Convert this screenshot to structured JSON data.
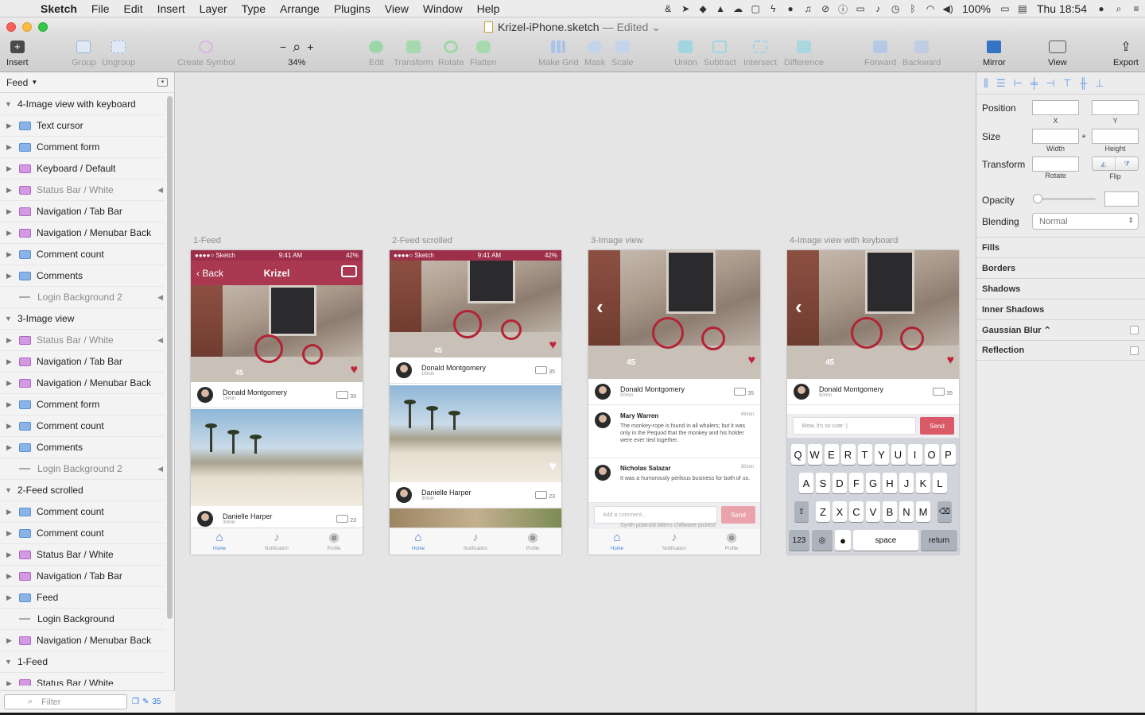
{
  "menubar": {
    "app_name": "Sketch",
    "items": [
      "File",
      "Edit",
      "Insert",
      "Layer",
      "Type",
      "Arrange",
      "Plugins",
      "View",
      "Window",
      "Help"
    ],
    "battery": "100%",
    "clock": "Thu 18:54"
  },
  "window": {
    "doc_title": "Krizel-iPhone.sketch",
    "dash": "—",
    "edited": "Edited"
  },
  "toolbar": {
    "insert": "Insert",
    "group": "Group",
    "ungroup": "Ungroup",
    "create_symbol": "Create Symbol",
    "zoom_minus": "−",
    "zoom_plus": "+",
    "zoom_level": "34%",
    "edit": "Edit",
    "transform": "Transform",
    "rotate": "Rotate",
    "flatten": "Flatten",
    "make_grid": "Make Grid",
    "mask": "Mask",
    "scale": "Scale",
    "union": "Union",
    "subtract": "Subtract",
    "intersect": "Intersect",
    "difference": "Difference",
    "forward": "Forward",
    "backward": "Backward",
    "mirror": "Mirror",
    "view": "View",
    "export": "Export"
  },
  "sidebar": {
    "page": "Feed",
    "filter_placeholder": "Filter",
    "count": "35",
    "layers": [
      {
        "label": "4-Image view with keyboard",
        "kind": "artboard"
      },
      {
        "label": "Text cursor",
        "kind": "folder",
        "color": "blue"
      },
      {
        "label": "Comment form",
        "kind": "folder",
        "color": "blue"
      },
      {
        "label": "Keyboard / Default",
        "kind": "folder",
        "color": "purple"
      },
      {
        "label": "Status Bar / White",
        "kind": "folder",
        "color": "purple",
        "hidden": true
      },
      {
        "label": "Navigation / Tab Bar",
        "kind": "folder",
        "color": "purple"
      },
      {
        "label": "Navigation / Menubar Back",
        "kind": "folder",
        "color": "purple"
      },
      {
        "label": "Comment count",
        "kind": "folder",
        "color": "blue"
      },
      {
        "label": "Comments",
        "kind": "folder",
        "color": "blue"
      },
      {
        "label": "Login Background 2",
        "kind": "rect",
        "hidden": true
      },
      {
        "label": "3-Image view",
        "kind": "artboard"
      },
      {
        "label": "Status Bar / White",
        "kind": "folder",
        "color": "purple",
        "hidden": true
      },
      {
        "label": "Navigation / Tab Bar",
        "kind": "folder",
        "color": "purple"
      },
      {
        "label": "Navigation / Menubar Back",
        "kind": "folder",
        "color": "purple"
      },
      {
        "label": "Comment form",
        "kind": "folder",
        "color": "blue"
      },
      {
        "label": "Comment count",
        "kind": "folder",
        "color": "blue"
      },
      {
        "label": "Comments",
        "kind": "folder",
        "color": "blue"
      },
      {
        "label": "Login Background 2",
        "kind": "rect",
        "hidden": true
      },
      {
        "label": "2-Feed scrolled",
        "kind": "artboard"
      },
      {
        "label": "Comment count",
        "kind": "folder",
        "color": "blue"
      },
      {
        "label": "Comment count",
        "kind": "folder",
        "color": "blue"
      },
      {
        "label": "Status Bar / White",
        "kind": "folder",
        "color": "purple"
      },
      {
        "label": "Navigation / Tab Bar",
        "kind": "folder",
        "color": "purple"
      },
      {
        "label": "Feed",
        "kind": "folder",
        "color": "blue"
      },
      {
        "label": "Login Background",
        "kind": "rect"
      },
      {
        "label": "Navigation / Menubar Back",
        "kind": "folder",
        "color": "purple"
      },
      {
        "label": "1-Feed",
        "kind": "artboard"
      },
      {
        "label": "Status Bar / White",
        "kind": "folder",
        "color": "purple"
      }
    ]
  },
  "canvas": {
    "artboards": [
      "1-Feed",
      "2-Feed scrolled",
      "3-Image view",
      "4-Image view with keyboard"
    ],
    "status": {
      "carrier": "●●●●○ Sketch",
      "time": "9:41 AM",
      "battery": "42%"
    },
    "nav": {
      "back": "Back",
      "title": "Krizel"
    },
    "posts": [
      {
        "name": "Donald Montgomery",
        "time": "16min",
        "count": "35"
      },
      {
        "name": "Danielle Harper",
        "time": "30min",
        "count": "23"
      }
    ],
    "post_50": {
      "name": "Donald Montgomery",
      "time": "50min",
      "count": "35"
    },
    "tabs": [
      "Home",
      "Notification",
      "Profile"
    ],
    "comments": [
      {
        "name": "Mary Warren",
        "time": "45min",
        "text": "The monkey-rope is found in all whalers; but it was only in the Pequod that the monkey and his holder were ever tied together."
      },
      {
        "name": "Nicholas Salazar",
        "time": "30min",
        "text": "It was a humorously perilous business for both of us."
      }
    ],
    "comment_placeholder": "Add a comment...",
    "comment_peek": "Synth polaroid bitters chillwave pickled",
    "send": "Send",
    "typed_comment": "Wow, it's so cute :)",
    "photo_plate": "45",
    "keyboard": {
      "row1": [
        "Q",
        "W",
        "E",
        "R",
        "T",
        "Y",
        "U",
        "I",
        "O",
        "P"
      ],
      "row2": [
        "A",
        "S",
        "D",
        "F",
        "G",
        "H",
        "J",
        "K",
        "L"
      ],
      "row3": [
        "Z",
        "X",
        "C",
        "V",
        "B",
        "N",
        "M"
      ],
      "num": "123",
      "space": "space",
      "return": "return"
    }
  },
  "inspector": {
    "position": "Position",
    "x": "X",
    "y": "Y",
    "size": "Size",
    "width": "Width",
    "height": "Height",
    "transform": "Transform",
    "rotate": "Rotate",
    "flip": "Flip",
    "opacity": "Opacity",
    "blending": "Blending",
    "blending_value": "Normal",
    "sections": [
      "Fills",
      "Borders",
      "Shadows",
      "Inner Shadows",
      "Gaussian Blur ⌃",
      "Reflection"
    ]
  },
  "colors": {
    "brand": "#a93850",
    "accent": "#3d7fd6",
    "send": "#d95a66"
  }
}
